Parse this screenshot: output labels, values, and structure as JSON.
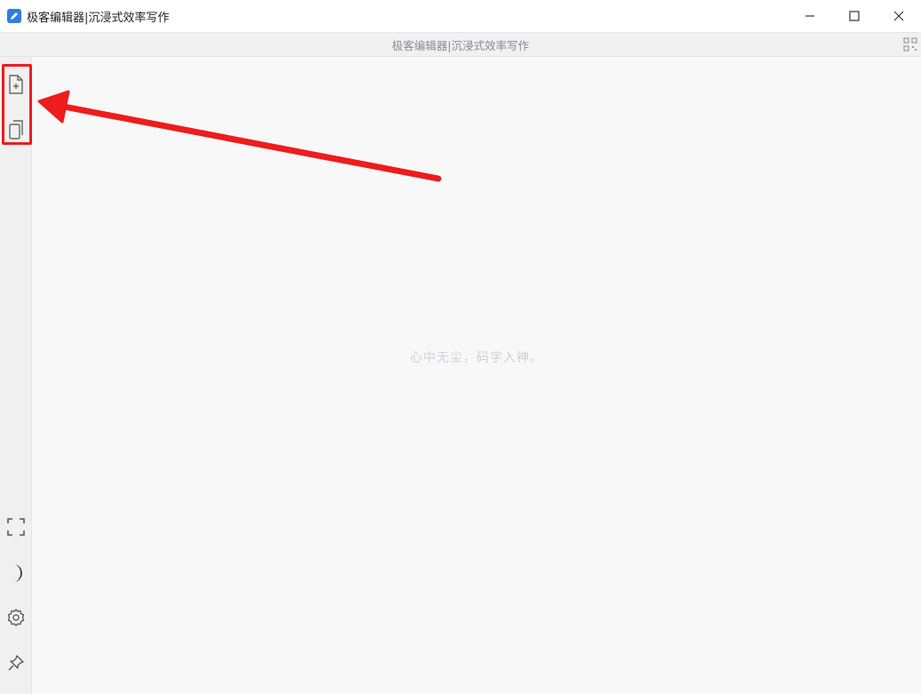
{
  "window": {
    "title": "极客编辑器|沉浸式效率写作"
  },
  "tabbar": {
    "title": "极客编辑器|沉浸式效率写作"
  },
  "editor": {
    "placeholder": "心中无尘，码字入神。"
  },
  "sidebar": {
    "top_icons": [
      "new-file-icon",
      "copy-file-icon"
    ],
    "bottom_icons": [
      "fullscreen-icon",
      "moon-icon",
      "gear-icon",
      "pin-icon"
    ]
  },
  "colors": {
    "accent": "#2f7de1",
    "annotation": "#ee1c1c"
  }
}
